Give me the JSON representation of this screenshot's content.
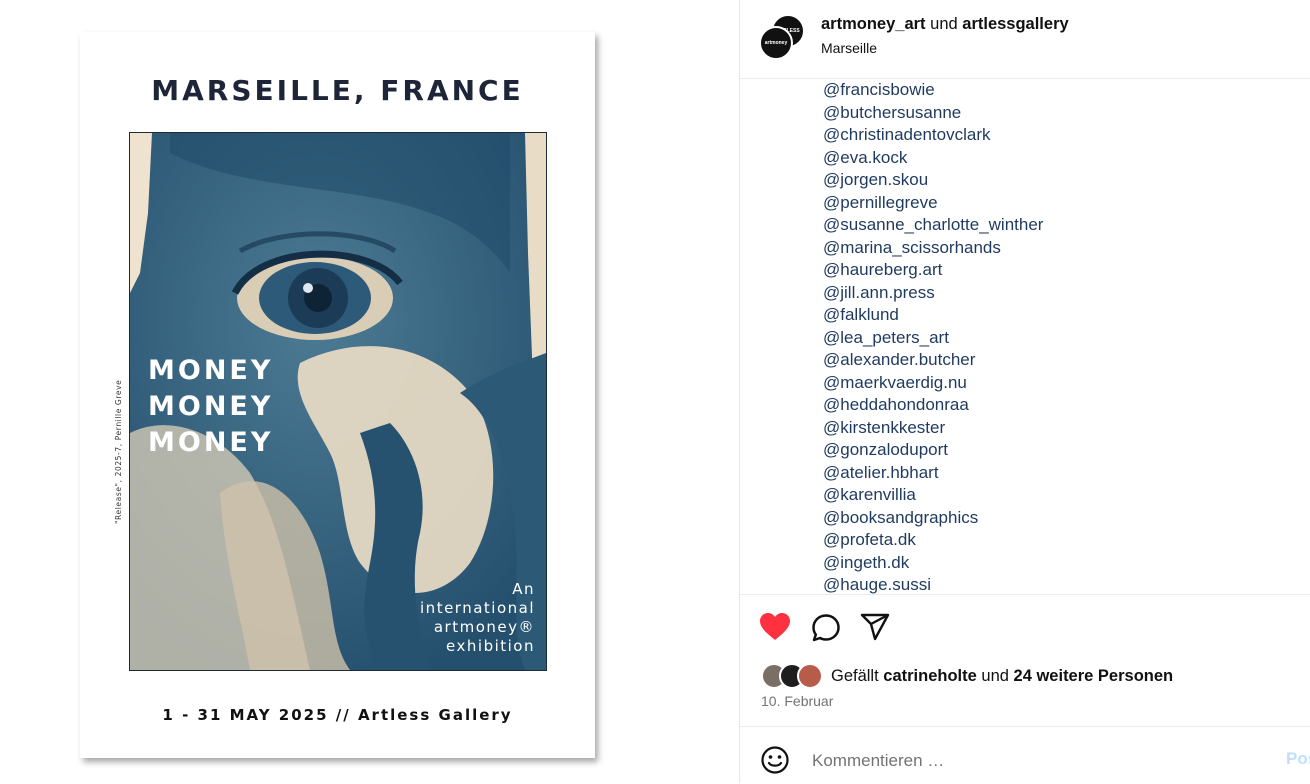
{
  "poster": {
    "title": "MARSEILLE, FRANCE",
    "headline": [
      "MONEY",
      "MONEY",
      "MONEY"
    ],
    "subtitle": [
      "An",
      "international",
      "artmoney®",
      "exhibition"
    ],
    "credit": "\"Release\", 2025-7, Pernille Greve",
    "date_line": "1 - 31 MAY 2025 // Artless Gallery"
  },
  "post": {
    "author_primary": "artmoney_art",
    "joiner": "und",
    "author_secondary": "artlessgallery",
    "location": "Marseille",
    "avatar_back_text": "ARTLESS",
    "avatar_front_text": "artmoney"
  },
  "caption": {
    "tags": [
      "@francisbowie",
      "@butchersusanne",
      "@christinadentovclark",
      "@eva.kock",
      "@jorgen.skou",
      "@pernillegreve",
      "@susanne_charlotte_winther",
      "@marina_scissorhands",
      "@haureberg.art",
      "@jill.ann.press",
      "@falklund",
      "@lea_peters_art",
      "@alexander.butcher",
      "@maerkvaerdig.nu",
      "@heddahondonraa",
      "@kirstenkkester",
      "@gonzaloduport",
      "@atelier.hbhart",
      "@karenvillia",
      "@booksandgraphics",
      "@profeta.dk",
      "@ingeth.dk",
      "@hauge.sussi"
    ]
  },
  "actions": {
    "like_icon": "heart-filled-icon",
    "comment_icon": "comment-bubble-icon",
    "share_icon": "paper-plane-icon",
    "like_color": "#ff3040"
  },
  "likes": {
    "prefix": "Gefällt",
    "user": "catrineholte",
    "middle": "und",
    "others": "24 weitere Personen"
  },
  "date": "10. Februar",
  "comment": {
    "placeholder": "Kommentieren …",
    "post_label": "Posten",
    "emoji_icon": "smiley-icon"
  }
}
